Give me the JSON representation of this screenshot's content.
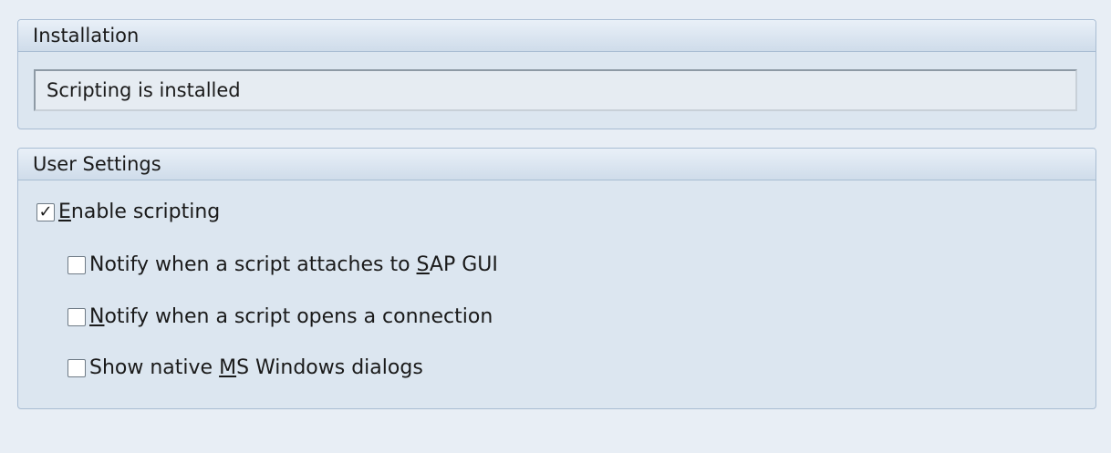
{
  "installation": {
    "title": "Installation",
    "status_text": "Scripting is installed"
  },
  "user_settings": {
    "title": "User Settings",
    "options": [
      {
        "id": "enable-scripting",
        "before": "",
        "mnemonic": "E",
        "after": "nable scripting",
        "checked": true
      },
      {
        "id": "notify-attach",
        "before": "Notify when a script attaches to ",
        "mnemonic": "S",
        "after": "AP GUI",
        "checked": false
      },
      {
        "id": "notify-connection",
        "before": "",
        "mnemonic": "N",
        "after": "otify when a script opens a connection",
        "checked": false
      },
      {
        "id": "native-dialogs",
        "before": "Show native ",
        "mnemonic": "M",
        "after": "S Windows dialogs",
        "checked": false
      }
    ],
    "checked_glyph": "✓"
  }
}
